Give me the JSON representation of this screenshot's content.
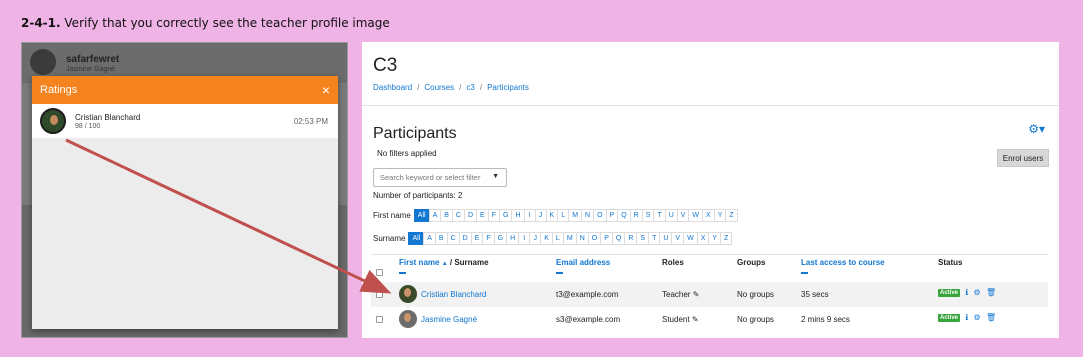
{
  "caption": {
    "number": "2-4-1.",
    "text": "Verify that you correctly see the teacher profile image"
  },
  "left_panel": {
    "user_name": "safarfewret",
    "user_sub": "Jasmine Gagné",
    "modal": {
      "title": "Ratings",
      "close": "×",
      "rows": [
        {
          "name": "Cristian Blanchard",
          "score": "98 / 100",
          "time": "02:53 PM"
        }
      ]
    }
  },
  "right_panel": {
    "course_title": "C3",
    "breadcrumb": [
      "Dashboard",
      "Courses",
      "c3",
      "Participants"
    ],
    "participants_title": "Participants",
    "no_filters": "No filters applied",
    "enrol_button": "Enrol users",
    "search_placeholder": "Search keyword or select filter",
    "num_participants": "Number of participants: 2",
    "first_name_label": "First name",
    "surname_label": "Surname",
    "all_label": "All",
    "letters": [
      "A",
      "B",
      "C",
      "D",
      "E",
      "F",
      "G",
      "H",
      "I",
      "J",
      "K",
      "L",
      "M",
      "N",
      "O",
      "P",
      "Q",
      "R",
      "S",
      "T",
      "U",
      "V",
      "W",
      "X",
      "Y",
      "Z"
    ],
    "table": {
      "headers": {
        "first_name": "First name",
        "surname": "/ Surname",
        "email": "Email address",
        "roles": "Roles",
        "groups": "Groups",
        "last_access": "Last access to course",
        "status": "Status"
      },
      "rows": [
        {
          "name": "Cristian Blanchard",
          "email": "t3@example.com",
          "role": "Teacher",
          "groups": "No groups",
          "last_access": "35 secs",
          "status": "Active"
        },
        {
          "name": "Jasmine Gagné",
          "email": "s3@example.com",
          "role": "Student",
          "groups": "No groups",
          "last_access": "2 mins 9 secs",
          "status": "Active"
        }
      ]
    }
  },
  "colors": {
    "orange": "#f5841f",
    "link_blue": "#1177d1",
    "arrow_red": "#c0504d",
    "active_green": "#39a33c",
    "background_pink": "#f0b3e6"
  }
}
